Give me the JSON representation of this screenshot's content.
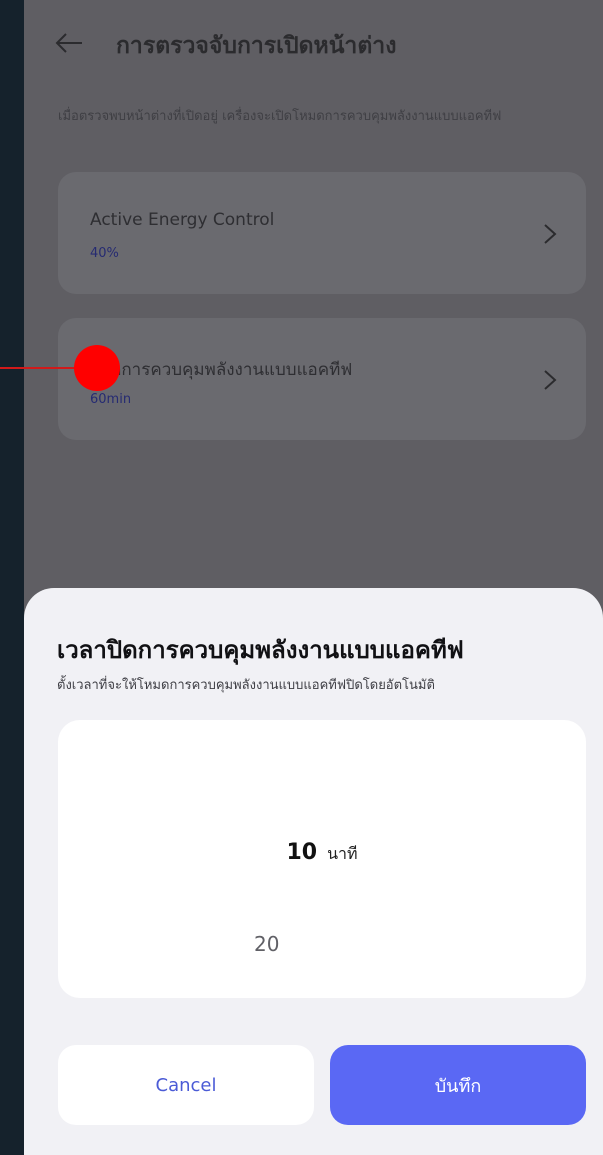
{
  "header": {
    "title": "การตรวจจับการเปิดหน้าต่าง"
  },
  "description": "เมื่อตรวจพบหน้าต่างที่เปิดอยู่ เครื่องจะเปิดโหมดการควบคุมพลังงานแบบแอคทีฟ",
  "settings": [
    {
      "title": "Active Energy Control",
      "value": "40%"
    },
    {
      "title": "าปิดการควบคุมพลังงานแบบแอคทีฟ",
      "value": "60min"
    }
  ],
  "sheet": {
    "title": "เวลาปิดการควบคุมพลังงานแบบแอคทีฟ",
    "subtitle": "ตั้งเวลาที่จะให้โหมดการควบคุมพลังงานแบบแอคทีฟปิดโดยอัตโนมัติ",
    "picker": {
      "selected_value": "10",
      "unit": "นาที",
      "next_value": "20"
    },
    "cancel_label": "Cancel",
    "save_label": "บันทึก"
  },
  "colors": {
    "accent": "#5a68f4",
    "overlay_marker": "#ff0000"
  }
}
